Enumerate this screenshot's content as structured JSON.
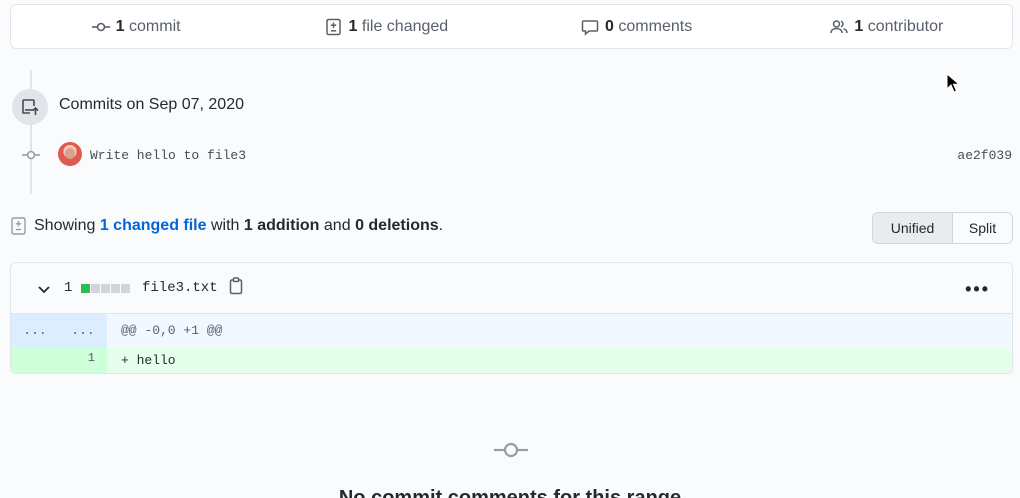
{
  "summary": {
    "commits": {
      "count": "1",
      "label": "commit",
      "icon": "commit-icon"
    },
    "files": {
      "count": "1",
      "label": "file changed",
      "icon": "file-diff-icon"
    },
    "comments": {
      "count": "0",
      "label": "comments",
      "icon": "comment-icon"
    },
    "contributors": {
      "count": "1",
      "label": "contributor",
      "icon": "people-icon"
    }
  },
  "timeline": {
    "heading": "Commits on Sep 07, 2020",
    "commit": {
      "message": "Write hello to file3",
      "sha": "ae2f039"
    }
  },
  "showing": {
    "prefix": "Showing",
    "changed_link": "1 changed file",
    "with": "with",
    "additions": "1 addition",
    "and": "and",
    "deletions": "0 deletions",
    "period": "."
  },
  "view_toggle": {
    "unified": "Unified",
    "split": "Split",
    "selected": "Unified"
  },
  "diff": {
    "change_count": "1",
    "filename": "file3.txt",
    "diffstat_colors": {
      "add": "#2cbe4e",
      "neutral": "#d1d5da"
    },
    "more": "•••",
    "hunk": {
      "old_num": "...",
      "new_num": "...",
      "header": "@@ -0,0 +1 @@"
    },
    "lines": [
      {
        "old": "",
        "new": "1",
        "text": "+ hello"
      }
    ]
  },
  "empty_comments": {
    "title": "No commit comments for this range"
  }
}
